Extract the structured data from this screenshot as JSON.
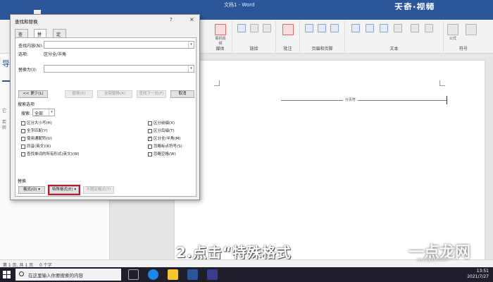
{
  "window": {
    "title": "文档1 - Word",
    "watermark_top": "天奇·视频"
  },
  "ribbon": {
    "groups": [
      {
        "label": "媒体"
      },
      {
        "label": "链接"
      },
      {
        "label": "批注"
      },
      {
        "label": "页眉和页脚"
      },
      {
        "label": "文本"
      },
      {
        "label": "符号"
      }
    ],
    "buttons": [
      {
        "label": "联机视频"
      },
      {
        "label": "公式"
      }
    ]
  },
  "navpane": {
    "title": "导",
    "hint_lines": [
      "它",
      "若",
      "转"
    ]
  },
  "document": {
    "section_break_label": "分页符"
  },
  "subtitle": "2.点击“特殊格式",
  "dialog": {
    "title": "查找和替换",
    "help": "?",
    "close": "×",
    "tabs": [
      {
        "label": "查找(D)"
      },
      {
        "label": "替换(P)"
      },
      {
        "label": "定位(G)"
      }
    ],
    "find_label": "查找内容(N):",
    "options_label": "选项:",
    "options_value": "区分全/半角",
    "replace_label": "替换为(I):",
    "less_button": "<< 更少(L)",
    "replace_button": "替换(R)",
    "replace_all_button": "全部替换(A)",
    "find_next_button": "查找下一处(F)",
    "cancel_button": "取消",
    "search_options_title": "搜索选项",
    "search_label": "搜索:",
    "search_value": "全部",
    "checks_left": [
      {
        "label": "区分大小写(H)",
        "checked": false
      },
      {
        "label": "全字匹配(Y)",
        "checked": false
      },
      {
        "label": "使用通配符(U)",
        "checked": false
      },
      {
        "label": "同音(英文)(K)",
        "checked": false
      },
      {
        "label": "查找单词的所有形式(英文)(W)",
        "checked": false
      }
    ],
    "checks_right": [
      {
        "label": "区分前缀(X)",
        "checked": false
      },
      {
        "label": "区分后缀(T)",
        "checked": false
      },
      {
        "label": "区分全/半角(M)",
        "checked": true
      },
      {
        "label": "忽略标点符号(S)",
        "checked": false
      },
      {
        "label": "忽略空格(W)",
        "checked": false
      }
    ],
    "replace_section_title": "替换",
    "format_button": "格式(O) ▾",
    "special_button": "特殊格式(E) ▾",
    "no_format_button": "不限定格式(T)"
  },
  "statusbar": {
    "page": "第 1 页, 共 1 页",
    "words": "0 个字"
  },
  "taskbar": {
    "search_placeholder": "在这里输入你要搜索的内容",
    "time": "13:51",
    "date": "2021/7/27"
  },
  "watermark": {
    "text": "一点龙网",
    "url": "www.ydlw.com"
  },
  "colors": {
    "word_blue": "#2b579a",
    "highlight_red": "#c0182b",
    "taskbar": "#1f1f2b"
  }
}
